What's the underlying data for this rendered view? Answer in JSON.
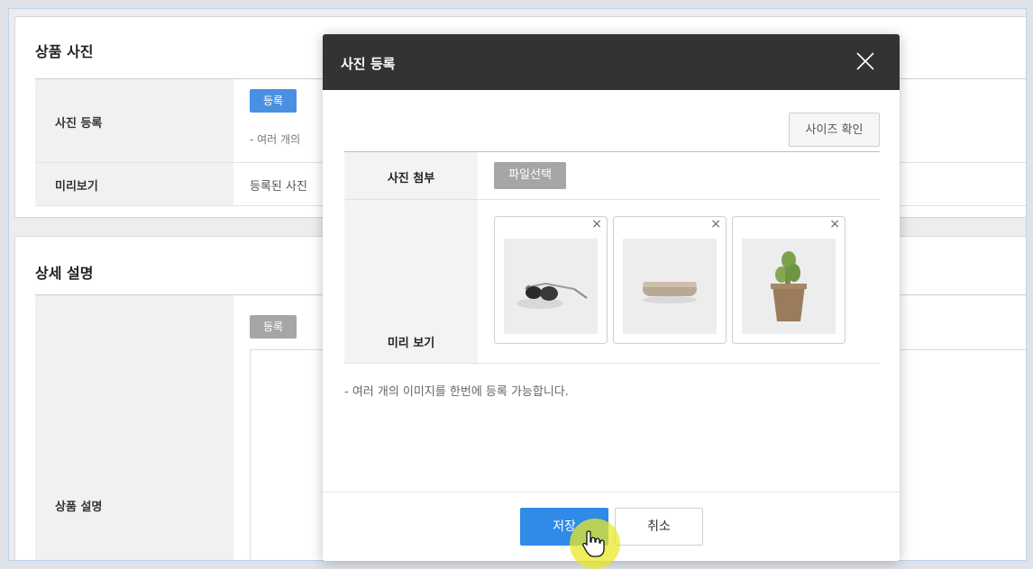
{
  "section_photo": {
    "title": "상품 사진",
    "register_label": "사진 등록",
    "register_button": "등록",
    "register_hint": "- 여러 개의",
    "preview_label": "미리보기",
    "preview_text": "등록된 사진"
  },
  "section_desc": {
    "title": "상세 설명",
    "register_button": "등록",
    "desc_label": "상품 설명"
  },
  "modal": {
    "title": "사진 등록",
    "size_check_button": "사이즈 확인",
    "attach_label": "사진 첨부",
    "file_select_button": "파일선택",
    "preview_label": "미리 보기",
    "thumbnails": [
      {
        "name": "sunglasses",
        "remove": "×"
      },
      {
        "name": "cylinder-object",
        "remove": "×"
      },
      {
        "name": "cactus-pot",
        "remove": "×"
      }
    ],
    "hint": "- 여러 개의 이미지를 한번에 등록 가능합니다.",
    "save_button": "저장",
    "cancel_button": "취소"
  },
  "colors": {
    "primary": "#2f8ae8",
    "header_dark": "#333333",
    "grey_button": "#a6a6a6"
  }
}
